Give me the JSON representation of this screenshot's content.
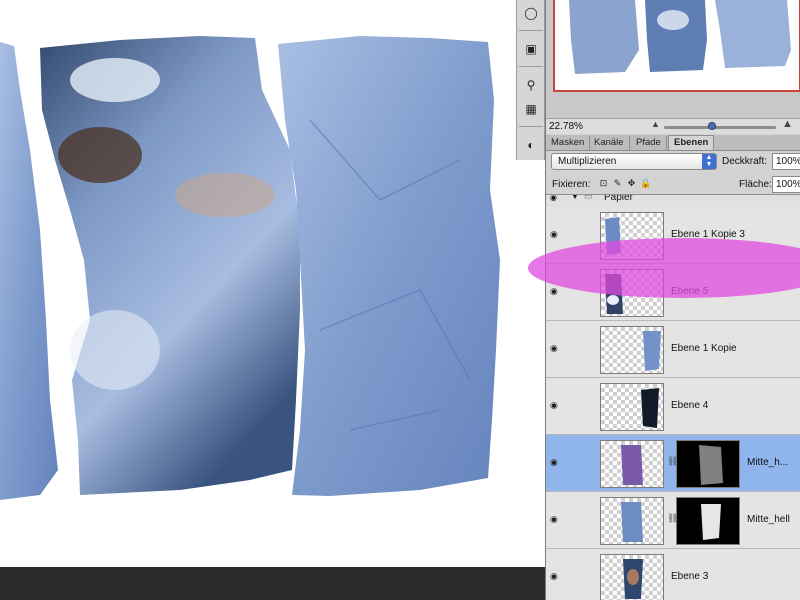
{
  "navigator": {
    "zoom": "22.78%"
  },
  "tabs": [
    {
      "label": "Masken"
    },
    {
      "label": "Kanäle"
    },
    {
      "label": "Pfade"
    },
    {
      "label": "Ebenen"
    }
  ],
  "blend": {
    "mode": "Multiplizieren",
    "opacity_label": "Deckkraft:",
    "opacity_value": "100%"
  },
  "lock": {
    "label": "Fixieren:",
    "fill_label": "Fläche:",
    "fill_value": "100%"
  },
  "group": {
    "name": "Papier"
  },
  "layers": [
    {
      "name": "Ebene 1 Kopie 3"
    },
    {
      "name": "Ebene 5"
    },
    {
      "name": "Ebene 1 Kopie"
    },
    {
      "name": "Ebene 4"
    },
    {
      "name": "Mitte_h..."
    },
    {
      "name": "Mitte_hell"
    },
    {
      "name": "Ebene 3"
    }
  ],
  "colors": {
    "accent": "#3f70d4",
    "highlight": "#e04ae0",
    "paper": "#8ea8d4"
  },
  "icons": {
    "eye": "eye-icon",
    "link": "chain-link-icon",
    "folder": "folder-icon"
  }
}
